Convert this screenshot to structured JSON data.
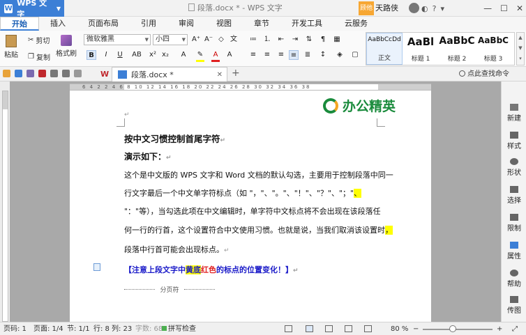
{
  "titlebar": {
    "app": "WPS 文字",
    "doc_title": "段落.docx * - WPS 文字",
    "member_badge": "顾他",
    "user": "天路侠"
  },
  "menu": {
    "tabs": [
      "开始",
      "插入",
      "页面布局",
      "引用",
      "审阅",
      "视图",
      "章节",
      "开发工具",
      "云服务"
    ],
    "active": "开始"
  },
  "ribbon": {
    "cut": "剪切",
    "copy": "复制",
    "paste": "粘贴",
    "format_painter": "格式刷",
    "font_name": "微软雅黑",
    "font_size": "小四",
    "styles": [
      {
        "sample": "AaBbCcDd",
        "label": "正文"
      },
      {
        "sample": "AaBl",
        "label": "标题 1"
      },
      {
        "sample": "AaBbC",
        "label": "标题 2"
      },
      {
        "sample": "AaBbC",
        "label": "标题 3"
      }
    ]
  },
  "tabs_row": {
    "doc_tab": "段落.docx *",
    "find": "点此查找命令"
  },
  "ruler": {
    "numbers": "6  4  2     2  4  6  8  10  12  14  16  18  20  22  24  26  28  30  32  34  36  38"
  },
  "logo": {
    "text": "办公精英"
  },
  "document": {
    "title": "按中文习惯控制首尾字符",
    "subtitle": "演示如下：",
    "lines": [
      "这个是中文版的 WPS 文字和 Word 文档的默认勾选，主要用于控制段落中同一",
      "行文字最后一个中文单字符标点（如 \"，\"、\"。\"、\"！\"、\"？\"、\"；\"",
      "\"：\"等），当勾选此项在中文编辑时，单字符中文标点将不会出现在该段落任",
      "何一行的行首，这个设置符合中文使用习惯。也就是说，当我们取消该设置时",
      "段落中行首可能会出现标点。"
    ],
    "hl_1": "、",
    "hl_2": "，",
    "note_a": "【注意上段文字中",
    "note_hl": "黄底",
    "note_red": "红色",
    "note_b": "的标点的位置变化！】",
    "page_break": "分页符"
  },
  "right_panel": [
    "新建",
    "样式",
    "形状",
    "选择",
    "限制",
    "属性",
    "帮助",
    "传图"
  ],
  "status": {
    "page_code": "页码: 1",
    "pages": "页面: 1/4",
    "section": "节: 1/1",
    "row": "行: 8",
    "col": "列: 23",
    "words": "字数: 680",
    "spell": "拼写检查",
    "zoom": "80 %"
  },
  "colors": {
    "accent": "#3c7fd6",
    "logo_green": "#1a8b3c",
    "logo_orange": "#f5a623",
    "note_blue": "#1919c8",
    "note_red": "#e02020",
    "highlight": "#ffff00"
  },
  "icons": [
    "wps-logo-icon",
    "member-icon",
    "avatar",
    "minimize-icon",
    "maximize-icon",
    "close-icon",
    "paste-icon",
    "cut-icon",
    "copy-icon",
    "format-painter-icon",
    "bold-icon",
    "italic-icon",
    "underline-icon",
    "search-icon",
    "paragraph-mark-icon"
  ]
}
